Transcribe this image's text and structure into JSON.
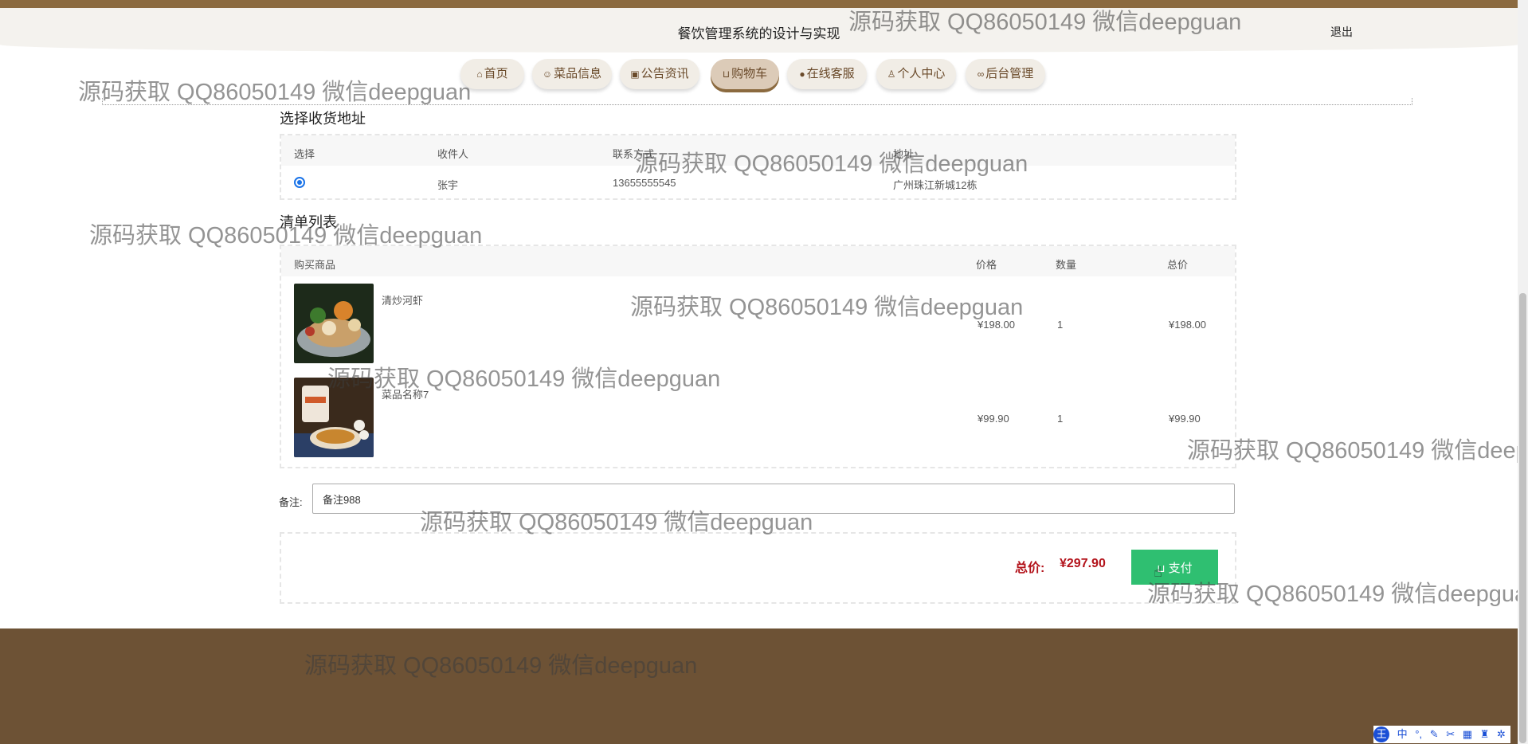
{
  "header": {
    "title": "餐饮管理系统的设计与实现",
    "logout": "退出"
  },
  "nav": [
    {
      "label": "首页",
      "icon": "home-icon"
    },
    {
      "label": "菜品信息",
      "icon": "dish-icon"
    },
    {
      "label": "公告资讯",
      "icon": "news-icon"
    },
    {
      "label": "购物车",
      "icon": "cart-icon",
      "active": true
    },
    {
      "label": "在线客服",
      "icon": "chat-icon"
    },
    {
      "label": "个人中心",
      "icon": "user-icon"
    },
    {
      "label": "后台管理",
      "icon": "link-icon"
    }
  ],
  "address": {
    "title": "选择收货地址",
    "headers": [
      "选择",
      "收件人",
      "联系方式",
      "地址"
    ],
    "rows": [
      {
        "name": "张宇",
        "phone": "13655555545",
        "addr": "广州珠江新城12栋",
        "selected": true
      }
    ]
  },
  "order": {
    "title": "清单列表",
    "headers": [
      "购买商品",
      "价格",
      "数量",
      "总价"
    ],
    "items": [
      {
        "name": "清炒河虾",
        "price": "¥198.00",
        "qty": "1",
        "total": "¥198.00"
      },
      {
        "name": "菜品名称7",
        "price": "¥99.90",
        "qty": "1",
        "total": "¥99.90"
      }
    ]
  },
  "remark": {
    "label": "备注:",
    "value": "备注988"
  },
  "summary": {
    "total_label": "总价:",
    "total_value": "¥297.90",
    "pay_label": "支付"
  },
  "watermark": "源码获取 QQ86050149 微信deepguan",
  "ime": {
    "logo": "王",
    "mode": "中",
    "symbols": "°,"
  },
  "colors": {
    "brand_brown": "#6d5235",
    "accent_green": "#2fbf71",
    "price_red": "#b3131b"
  }
}
